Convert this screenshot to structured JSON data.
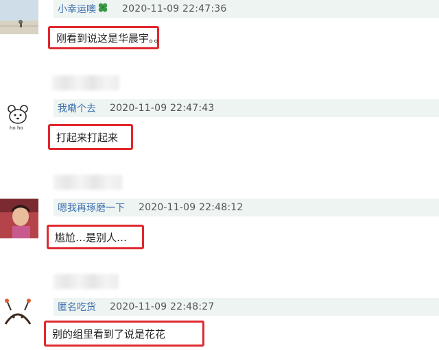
{
  "comments": [
    {
      "username": "小幸运噢",
      "has_clover": true,
      "timestamp": "2020-11-09 22:47:36",
      "text": "刚看到说这是华晨宇。。"
    },
    {
      "username": "我嘞个去",
      "has_clover": false,
      "timestamp": "2020-11-09 22:47:43",
      "text": "打起来打起来"
    },
    {
      "username": "嗯我再琢磨一下",
      "has_clover": false,
      "timestamp": "2020-11-09 22:48:12",
      "text": "尴尬…是别人…"
    },
    {
      "username": "匿名吃货",
      "has_clover": false,
      "timestamp": "2020-11-09 22:48:27",
      "text": "别的组里看到了说是花花"
    }
  ],
  "avatars": [
    "landscape-photo-avatar",
    "cartoon-bear-avatar",
    "man-photo-avatar",
    "cartoon-bug-avatar"
  ],
  "colors": {
    "username": "#3d6fb0",
    "header_bg": "#eef4f1",
    "highlight_border": "#e0282e"
  },
  "icons": {
    "clover": "four-leaf-clover-icon"
  }
}
